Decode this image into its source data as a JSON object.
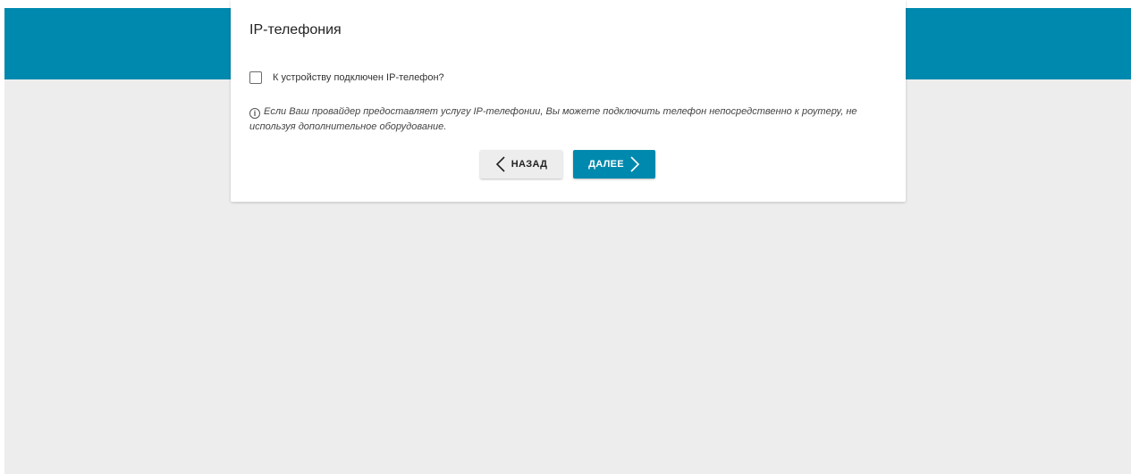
{
  "colors": {
    "brand": "#0089ae",
    "background": "#ededed",
    "card": "#ffffff"
  },
  "card": {
    "title": "IP-телефония",
    "checkbox": {
      "label": "К устройству подключен IP-телефон?",
      "checked": false
    },
    "hint": {
      "icon": "info-icon",
      "text": "Если Ваш провайдер предоставляет услугу IP-телефонии, Вы можете подключить телефон непосредственно к роутеру, не используя дополнительное оборудование."
    },
    "buttons": {
      "back_label": "НАЗАД",
      "back_icon": "chevron-left-icon",
      "next_label": "ДАЛЕЕ",
      "next_icon": "chevron-right-icon"
    }
  }
}
